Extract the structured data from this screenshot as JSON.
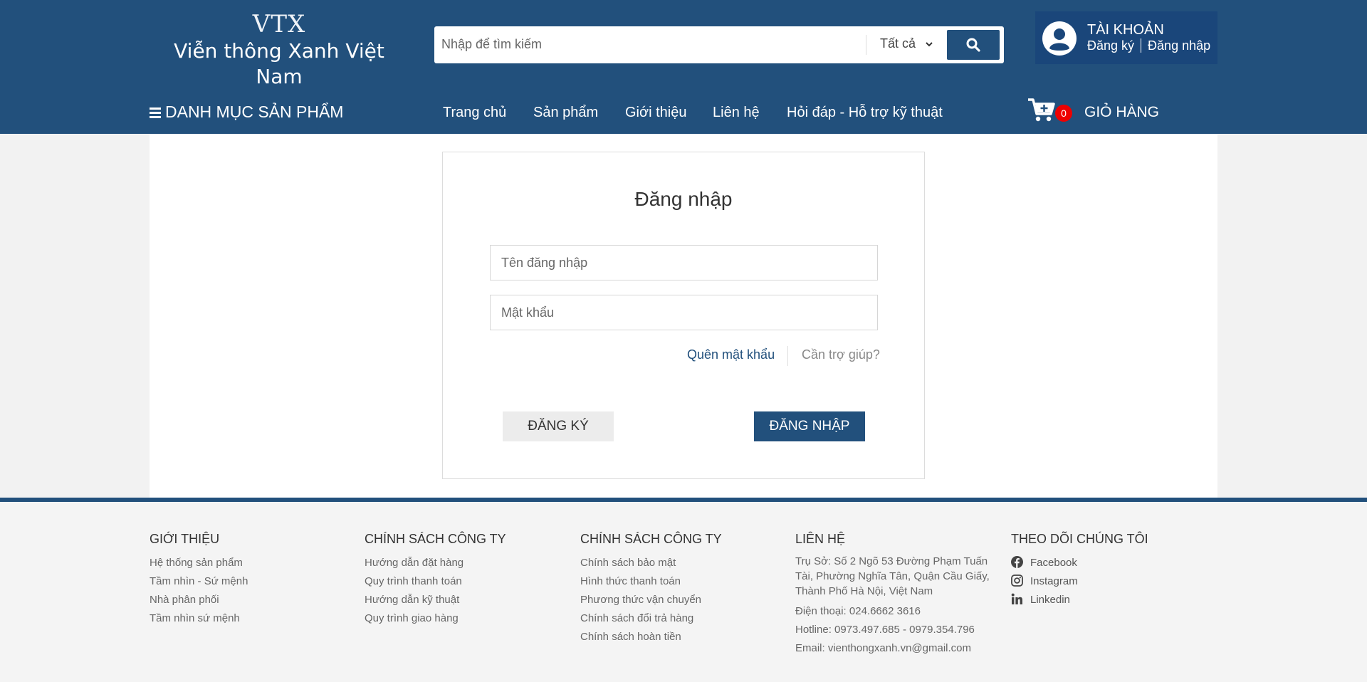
{
  "header": {
    "logo_mark": "VTX",
    "logo_text": "Viễn thông Xanh Việt Nam",
    "search_placeholder": "Nhập để tìm kiếm",
    "search_category": "Tất cả",
    "account_title": "TÀI KHOẢN",
    "account_register": "Đăng ký",
    "account_login": "Đăng nhập"
  },
  "nav": {
    "category_label": "DANH MỤC SẢN PHẨM",
    "items": [
      "Trang chủ",
      "Sản phẩm",
      "Giới thiệu",
      "Liên hệ",
      "Hỏi đáp - Hỗ trợ kỹ thuật"
    ],
    "cart_count": "0",
    "cart_label": "GIỎ HÀNG"
  },
  "login": {
    "title": "Đăng nhập",
    "username_placeholder": "Tên đăng nhập",
    "password_placeholder": "Mật khẩu",
    "forgot": "Quên mật khẩu",
    "help": "Cần trợ giúp?",
    "register_button": "ĐĂNG KÝ",
    "login_button": "ĐĂNG NHẬP"
  },
  "footer": {
    "col1": {
      "title": "GIỚI THIỆU",
      "items": [
        "Hệ thống sản phẩm",
        "Tầm nhìn - Sứ mệnh",
        "Nhà phân phối",
        "Tầm nhìn sứ mệnh"
      ]
    },
    "col2": {
      "title": "CHÍNH SÁCH CÔNG TY",
      "items": [
        "Hướng dẫn đặt hàng",
        "Quy trình thanh toán",
        "Hướng dẫn kỹ thuật",
        "Quy trình giao hàng"
      ]
    },
    "col3": {
      "title": "CHÍNH SÁCH CÔNG TY",
      "items": [
        "Chính sách bảo mật",
        "Hình thức thanh toán",
        "Phương thức vận chuyển",
        "Chính sách đổi trả hàng",
        "Chính sách hoàn tiền"
      ]
    },
    "col4": {
      "title": "LIÊN HỆ",
      "address": "Trụ Sở: Số 2 Ngõ 53 Đường Phạm Tuấn Tài, Phường Nghĩa Tân, Quận Cầu Giấy, Thành Phố Hà Nội, Việt Nam",
      "phone": "Điện thoại: 024.6662 3616",
      "hotline": "Hotline: 0973.497.685 - 0979.354.796",
      "email": "Email: vienthongxanh.vn@gmail.com"
    },
    "col5": {
      "title": "THEO DÕI CHÚNG TÔI",
      "facebook": "Facebook",
      "instagram": "Instagram",
      "linkedin": "Linkedin"
    }
  },
  "colors": {
    "brand": "#22507c",
    "account_bg": "#1a467a",
    "badge": "#ee0000"
  },
  "icons": [
    "search-icon",
    "chevron-down-icon",
    "user-avatar-icon",
    "menu-bars-icon",
    "cart-icon",
    "facebook-icon",
    "instagram-icon",
    "linkedin-icon"
  ]
}
